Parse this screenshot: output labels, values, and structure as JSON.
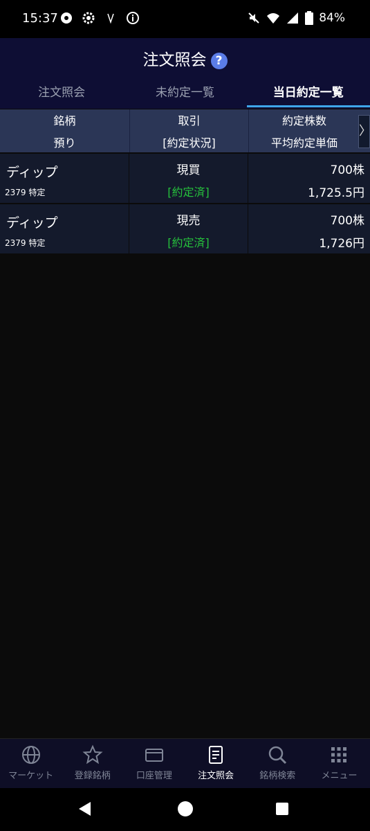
{
  "status_bar": {
    "time": "15:37",
    "battery": "84%"
  },
  "header": {
    "title": "注文照会",
    "help": "?"
  },
  "tabs": [
    {
      "label": "注文照会",
      "active": false
    },
    {
      "label": "未約定一覧",
      "active": false
    },
    {
      "label": "当日約定一覧",
      "active": true
    }
  ],
  "table": {
    "columns": [
      {
        "top": "銘柄",
        "bottom": "預り"
      },
      {
        "top": "取引",
        "bottom": "[約定状況]"
      },
      {
        "top": "約定株数",
        "bottom": "平均約定単価"
      }
    ],
    "scroll_indicator": "〉",
    "rows": [
      {
        "name": "ディップ",
        "code": "2379 特定",
        "type": "現買",
        "status": "[約定済]",
        "qty": "700株",
        "price": "1,725.5円"
      },
      {
        "name": "ディップ",
        "code": "2379 特定",
        "type": "現売",
        "status": "[約定済]",
        "qty": "700株",
        "price": "1,726円"
      }
    ]
  },
  "bottom_nav": [
    {
      "label": "マーケット",
      "icon": "globe-icon"
    },
    {
      "label": "登録銘柄",
      "icon": "star-icon"
    },
    {
      "label": "口座管理",
      "icon": "card-icon"
    },
    {
      "label": "注文照会",
      "icon": "document-icon",
      "active": true
    },
    {
      "label": "銘柄検索",
      "icon": "search-icon"
    },
    {
      "label": "メニュー",
      "icon": "grid-icon"
    }
  ],
  "colors": {
    "accent": "#3fa6e8",
    "executed": "#26c13c",
    "header_bg": "#0e0e34"
  }
}
